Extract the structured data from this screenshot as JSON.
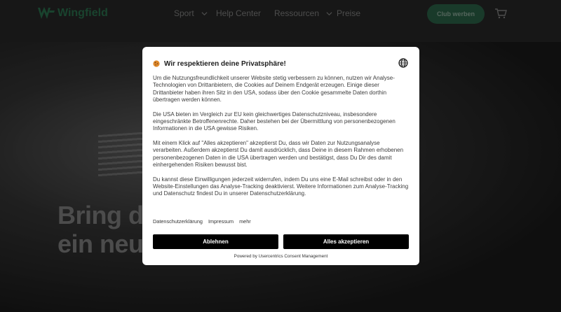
{
  "site": {
    "brand": "Wingfield",
    "brand_color": "#2e7a55",
    "nav": [
      {
        "label": "Sport",
        "has_dropdown": true
      },
      {
        "label": "Help Center",
        "has_dropdown": false
      },
      {
        "label": "Ressourcen",
        "has_dropdown": true
      },
      {
        "label": "Preise",
        "has_dropdown": false
      }
    ],
    "cta_label": "Club werben",
    "cart_icon": "cart-icon",
    "hero_line_1": "Bring de",
    "hero_line_2": "ein neue"
  },
  "consent": {
    "icon": "cookie-icon",
    "title": "Wir respektieren deine Privatsphäre!",
    "language_icon": "globe-icon",
    "paragraphs": [
      "Um die Nutzungsfreundlichkeit unserer Website stetig verbessern zu können, nutzen wir Analyse-Technologien von Drittanbietern, die Cookies auf Deinem Endgerät erzeugen. Einige dieser Drittanbieter haben ihren Sitz in den USA, sodass über den Cookie gesammelte Daten dorthin übertragen werden können.",
      "Die USA bieten im Vergleich zur EU kein gleichwertiges Datenschutzniveau, insbesondere eingeschränkte Betroffenenrechte. Daher bestehen bei der Übermittlung von personenbezogenen Informationen in die USA gewisse Risiken.",
      "Mit einem Klick auf \"Alles akzeptieren\" akzeptierst Du, dass wir Daten zur Nutzungsanalyse verarbeiten. Außerdem akzeptierst Du damit ausdrücklich, dass Deine in diesem Rahmen erhobenen personenbezogenen Daten in die USA übertragen werden und bestätigst, dass Du Dir des damit einhergehenden Risiken bewusst bist.",
      "Du kannst diese Einwilligungen jederzeit widerrufen, indem Du uns eine E-Mail schreibst oder in den Website-Einstellungen das Analyse-Tracking deaktivierst. Weitere Informationen zum Analyse-Tracking und Datenschutz findest Du in unserer Datenschutzerklärung."
    ],
    "links": {
      "privacy": "Datenschutzerklärung",
      "imprint": "Impressum",
      "more": "mehr"
    },
    "deny_label": "Ablehnen",
    "accept_label": "Alles akzeptieren",
    "powered_by": "Powered by Usercentrics Consent Management"
  }
}
